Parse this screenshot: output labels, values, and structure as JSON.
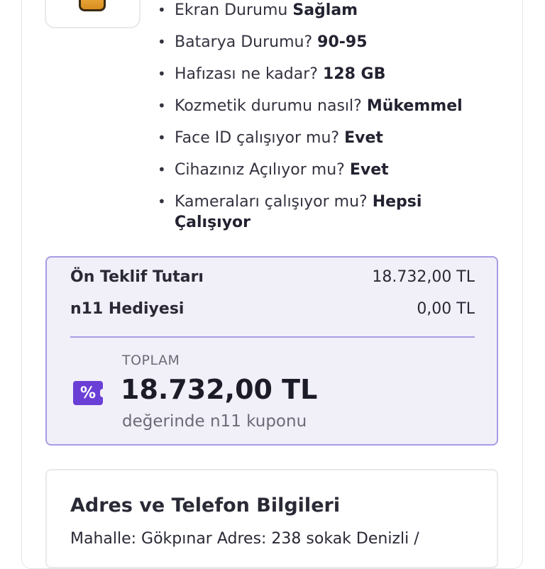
{
  "specs": [
    {
      "question": "Ekran Durumu",
      "answer": "Sağlam"
    },
    {
      "question": "Batarya Durumu?",
      "answer": "90-95"
    },
    {
      "question": "Hafızası ne kadar?",
      "answer": "128 GB"
    },
    {
      "question": "Kozmetik durumu nasıl?",
      "answer": "Mükemmel"
    },
    {
      "question": "Face ID çalışıyor mu?",
      "answer": "Evet"
    },
    {
      "question": "Cihazınız Açılıyor mu?",
      "answer": "Evet"
    },
    {
      "question": "Kameraları çalışıyor mu?",
      "answer": "Hepsi Çalışıyor"
    }
  ],
  "offer": {
    "pre_offer_label": "Ön Teklif Tutarı",
    "pre_offer_value": "18.732,00 TL",
    "gift_label": "n11 Hediyesi",
    "gift_value": "0,00 TL",
    "total_label": "TOPLAM",
    "total_value": "18.732,00 TL",
    "coupon_note": "değerinde n11 kuponu",
    "coupon_icon_symbol": "%"
  },
  "address": {
    "title": "Adres ve Telefon Bilgileri",
    "line": "Mahalle: Gökpınar Adres: 238 sokak Denizli /"
  },
  "colors": {
    "accent": "#6a3fd6",
    "offer_border": "#a99be6",
    "offer_bg": "#f1eff8"
  }
}
